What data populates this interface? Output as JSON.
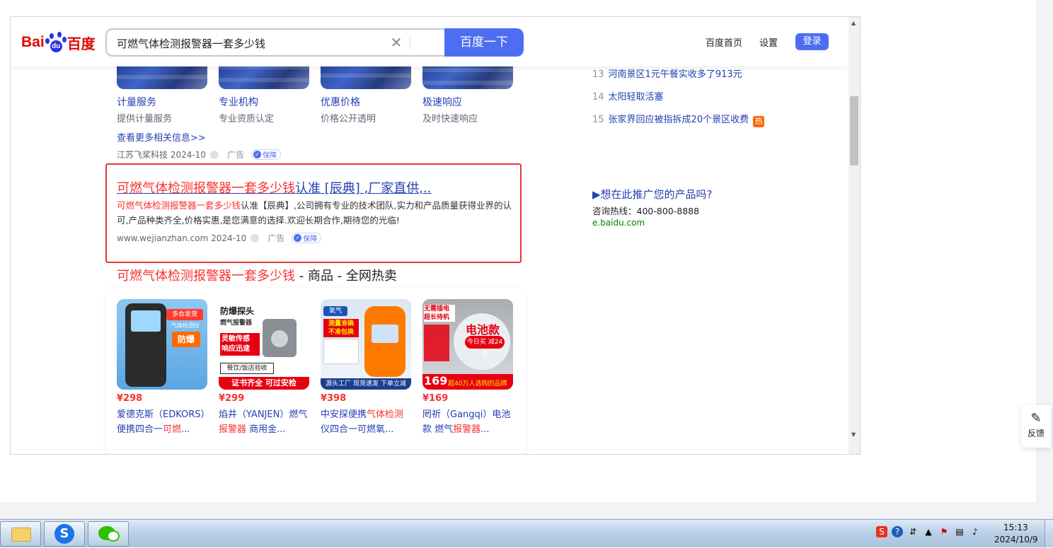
{
  "header": {
    "logo_latin": "Bai",
    "logo_paw": "du",
    "logo_cn": "百度",
    "search_value": "可燃气体检测报警器一套多少钱",
    "search_button": "百度一下",
    "links": [
      "百度首页",
      "设置"
    ],
    "login": "登录"
  },
  "tiles": [
    {
      "title": "计量服务",
      "sub": "提供计量服务"
    },
    {
      "title": "专业机构",
      "sub": "专业资质认定"
    },
    {
      "title": "优惠价格",
      "sub": "价格公开透明"
    },
    {
      "title": "极速响应",
      "sub": "及时快速响应"
    }
  ],
  "ad1": {
    "more_link": "查看更多相关信息>>",
    "source": "江苏飞桨科技 2024-10",
    "ad_label": "广告",
    "guarantee": "保障"
  },
  "ad2": {
    "title_hl": "可燃气体检测报警器一套多少钱",
    "title_rest": "认准 [辰典] ,厂家直供,..",
    "desc_hl": "可燃气体检测报警器一套多少钱",
    "desc_rest": "认准【辰典】,公司拥有专业的技术团队,实力和产品质量获得业界的认可,产品种类齐全,价格实惠,是您满意的选择.欢迎长期合作,期待您的光临!",
    "source": "www.wejianzhan.com 2024-10",
    "ad_label": "广告",
    "guarantee": "保障"
  },
  "shopping": {
    "title_hl": "可燃气体检测报警器一套多少钱",
    "title_rest": " - 商品 - 全网热卖",
    "products": [
      {
        "price": "¥298",
        "name_a": "爱德克斯（EDKORS）便携四合一",
        "name_hl": "可燃",
        "name_b": "...",
        "img_text": [
          "多合发货",
          "气体检测仪",
          "防爆"
        ]
      },
      {
        "price": "¥299",
        "name_a": "焰井（YANJEN）燃气",
        "name_hl": "报警器",
        "name_b": " 商用金...",
        "img_text": [
          "防爆探头",
          "燃气报警器",
          "灵敏传感",
          "响应迅速",
          "餐饮/饭店验收",
          "证书齐全 可过安检"
        ]
      },
      {
        "price": "¥398",
        "name_a": "中安探便携",
        "name_hl": "气体检测",
        "name_b": "仪四合一可燃氧...",
        "img_text": [
          "氧气",
          "测量准确",
          "不准包换",
          "源头工厂 现货速发 下单立减"
        ]
      },
      {
        "price": "¥169",
        "name_a": "罔祈（Gangqi）电池款 燃气",
        "name_hl": "报警器",
        "name_b": "...",
        "img_text": [
          "无需插电",
          "超长待机",
          "电池款",
          "今日买 减24元",
          "169",
          "超40万人选购的品牌"
        ]
      }
    ]
  },
  "hot_list": [
    {
      "num": "13",
      "text": "河南景区1元午餐实收多了913元",
      "badge": ""
    },
    {
      "num": "14",
      "text": "太阳轻取活塞",
      "badge": ""
    },
    {
      "num": "15",
      "text": "张家界回应被指拆成20个景区收费",
      "badge": "热"
    }
  ],
  "promo": {
    "title": "▶想在此推广您的产品吗?",
    "hotline": "咨询热线：400-800-8888",
    "url": "e.baidu.com"
  },
  "feedback": "反馈",
  "taskbar": {
    "time": "15:13",
    "date": "2024/10/9"
  },
  "colors": {
    "accent": "#4e6ef2",
    "link": "#2440b3",
    "highlight": "#f73131",
    "box": "#e53935"
  }
}
